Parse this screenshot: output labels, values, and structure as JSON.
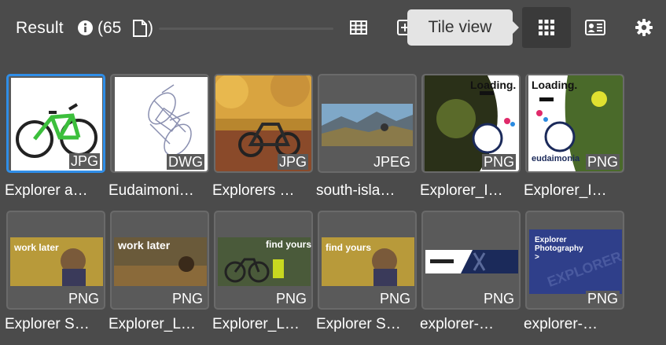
{
  "toolbar": {
    "result_label": "Result",
    "count_text": "(65",
    "count_close": ")",
    "tooltip_text": "Tile view"
  },
  "tiles": [
    {
      "file_type": "JPG",
      "name": "Explorer a…",
      "thumb": "green-bike"
    },
    {
      "file_type": "DWG",
      "name": "Eudaimoni…",
      "thumb": "bike-drawing"
    },
    {
      "file_type": "JPG",
      "name": "Explorers …",
      "thumb": "autumn-bike"
    },
    {
      "file_type": "JPEG",
      "name": "south-isla…",
      "thumb": "mountain-rider"
    },
    {
      "file_type": "PNG",
      "name": "Explorer_I…",
      "thumb": "loading-ad-rider"
    },
    {
      "file_type": "PNG",
      "name": "Explorer_I…",
      "thumb": "loading-ad-jump"
    },
    {
      "file_type": "PNG",
      "name": "Explorer S…",
      "thumb": "work-later-banner",
      "banner_text": "work later"
    },
    {
      "file_type": "PNG",
      "name": "Explorer_L…",
      "thumb": "work-later-banner-2",
      "banner_text": "work later"
    },
    {
      "file_type": "PNG",
      "name": "Explorer_L…",
      "thumb": "find-yours-banner",
      "banner_text": "find yours"
    },
    {
      "file_type": "PNG",
      "name": "Explorer S…",
      "thumb": "find-yours-banner-2",
      "banner_text": "find yours"
    },
    {
      "file_type": "PNG",
      "name": "explorer-…",
      "thumb": "explorer-x-banner"
    },
    {
      "file_type": "PNG",
      "name": "explorer-…",
      "thumb": "explorer-photography-banner",
      "banner_text": "Explorer Photography >"
    }
  ],
  "loading_text": "Loading.",
  "brand_text": "eudaimonia",
  "explorer_word": "EXPLORER",
  "colors": {
    "background": "#4b4b4b",
    "selected_border": "#2f8ee8",
    "tooltip_bg": "#e4e4e4"
  },
  "icons": [
    "info-icon",
    "document-icon",
    "table-view-icon",
    "add-icon",
    "tile-view-icon",
    "card-view-icon",
    "settings-gear-icon"
  ]
}
